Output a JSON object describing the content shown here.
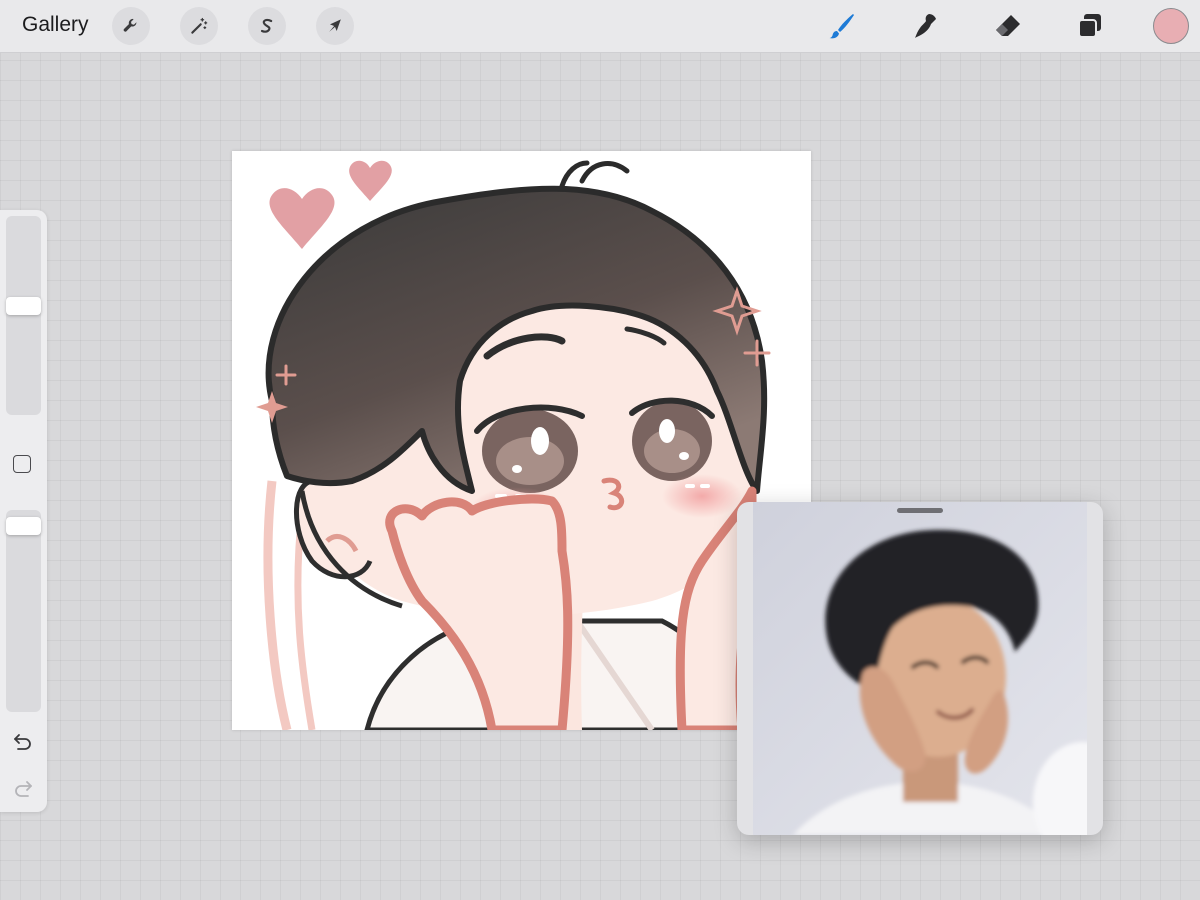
{
  "toolbar": {
    "gallery_label": "Gallery",
    "left_tools": [
      {
        "name": "actions",
        "icon": "wrench-icon"
      },
      {
        "name": "adjustments",
        "icon": "magic-wand-icon"
      },
      {
        "name": "selection",
        "icon": "selection-s-icon"
      },
      {
        "name": "transform",
        "icon": "arrow-cursor-icon"
      }
    ],
    "right_tools": [
      {
        "name": "paint",
        "icon": "brush-icon",
        "active": true
      },
      {
        "name": "smudge",
        "icon": "smudge-icon",
        "active": false
      },
      {
        "name": "erase",
        "icon": "eraser-icon",
        "active": false
      },
      {
        "name": "layers",
        "icon": "layers-icon",
        "active": false
      }
    ],
    "active_color": "#e8aeb3",
    "accent_color": "#1e7bd6"
  },
  "sidebar": {
    "brush_size_level": 0.55,
    "opacity_level": 0.96,
    "undo_icon": "undo-icon",
    "redo_icon": "redo-icon"
  },
  "canvas": {
    "background": "#ffffff",
    "hair_color": "#3d3d3d",
    "skin_color": "#fbe6df",
    "line_color": "#d98378",
    "heart_color": "#e2a0a4"
  },
  "reference": {
    "backdrop_color": "#d6d8e2",
    "hair_color": "#222326",
    "skin_color": "#d9a98a",
    "shirt_color": "#f2f2f4"
  }
}
